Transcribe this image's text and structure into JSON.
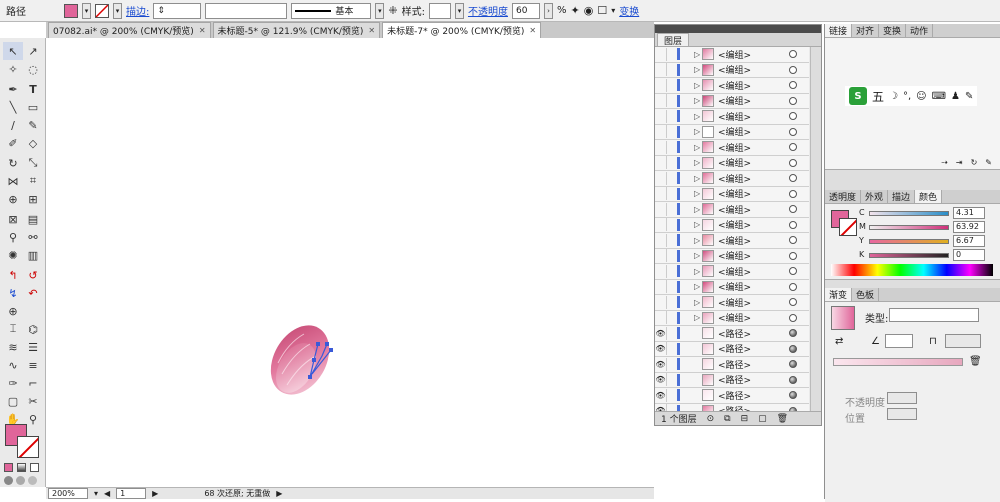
{
  "control_bar": {
    "object_type": "路径",
    "stroke_label": "描边:",
    "stroke_style": "基本",
    "style_label": "样式:",
    "opacity_label": "不透明度",
    "opacity_value": "60",
    "opacity_unit": "%",
    "transform_label": "变换",
    "fill_color": "#e0659a"
  },
  "tabs": [
    {
      "label": "07082.ai* @ 200% (CMYK/预览)",
      "close": "✕"
    },
    {
      "label": "未标题-5* @ 121.9% (CMYK/预览)",
      "close": "✕"
    },
    {
      "label": "未标题-7* @ 200% (CMYK/预览)",
      "close": "✕"
    }
  ],
  "status_bar": {
    "zoom": "200%",
    "page": "1",
    "history": "68 次还原; 无重做"
  },
  "layers_panel": {
    "title": "图层",
    "rows": [
      {
        "name": "<编组>",
        "visible": false,
        "expand": "▷"
      },
      {
        "name": "<编组>",
        "visible": false,
        "expand": "▷"
      },
      {
        "name": "<编组>",
        "visible": false,
        "expand": "▷"
      },
      {
        "name": "<编组>",
        "visible": false,
        "expand": "▷"
      },
      {
        "name": "<编组>",
        "visible": false,
        "expand": "▷"
      },
      {
        "name": "<编组>",
        "visible": false,
        "expand": "▷"
      },
      {
        "name": "<编组>",
        "visible": false,
        "expand": "▷"
      },
      {
        "name": "<编组>",
        "visible": false,
        "expand": "▷"
      },
      {
        "name": "<编组>",
        "visible": false,
        "expand": "▷"
      },
      {
        "name": "<编组>",
        "visible": false,
        "expand": "▷"
      },
      {
        "name": "<编组>",
        "visible": false,
        "expand": "▷"
      },
      {
        "name": "<编组>",
        "visible": false,
        "expand": "▷"
      },
      {
        "name": "<编组>",
        "visible": false,
        "expand": "▷"
      },
      {
        "name": "<编组>",
        "visible": false,
        "expand": "▷"
      },
      {
        "name": "<编组>",
        "visible": false,
        "expand": "▷"
      },
      {
        "name": "<编组>",
        "visible": false,
        "expand": "▷"
      },
      {
        "name": "<编组>",
        "visible": false,
        "expand": "▷"
      },
      {
        "name": "<编组>",
        "visible": false,
        "expand": "▷"
      },
      {
        "name": "<路径>",
        "visible": true,
        "expand": ""
      },
      {
        "name": "<路径>",
        "visible": true,
        "expand": ""
      },
      {
        "name": "<路径>",
        "visible": true,
        "expand": ""
      },
      {
        "name": "<路径>",
        "visible": true,
        "expand": ""
      },
      {
        "name": "<路径>",
        "visible": true,
        "expand": ""
      },
      {
        "name": "<路径>",
        "visible": true,
        "expand": ""
      }
    ],
    "footer": "1 个图层"
  },
  "right_panels": {
    "top_tabs": [
      "链接",
      "对齐",
      "变换",
      "动作"
    ],
    "color_tabs": [
      "透明度",
      "外观",
      "描边",
      "颜色"
    ],
    "cmyk": [
      {
        "label": "C",
        "value": "4.31",
        "fill": 0.0431,
        "color": "#2a8ec8"
      },
      {
        "label": "M",
        "value": "63.92",
        "fill": 0.6392,
        "color": "#d0307a"
      },
      {
        "label": "Y",
        "value": "6.67",
        "fill": 0.0667,
        "color": "#e0b020"
      },
      {
        "label": "K",
        "value": "0",
        "fill": 0,
        "color": "#333333"
      }
    ],
    "gradient_tabs": [
      "渐变",
      "色板"
    ],
    "type_label": "类型:",
    "opacity_label": "不透明度",
    "position_label": "位置"
  }
}
